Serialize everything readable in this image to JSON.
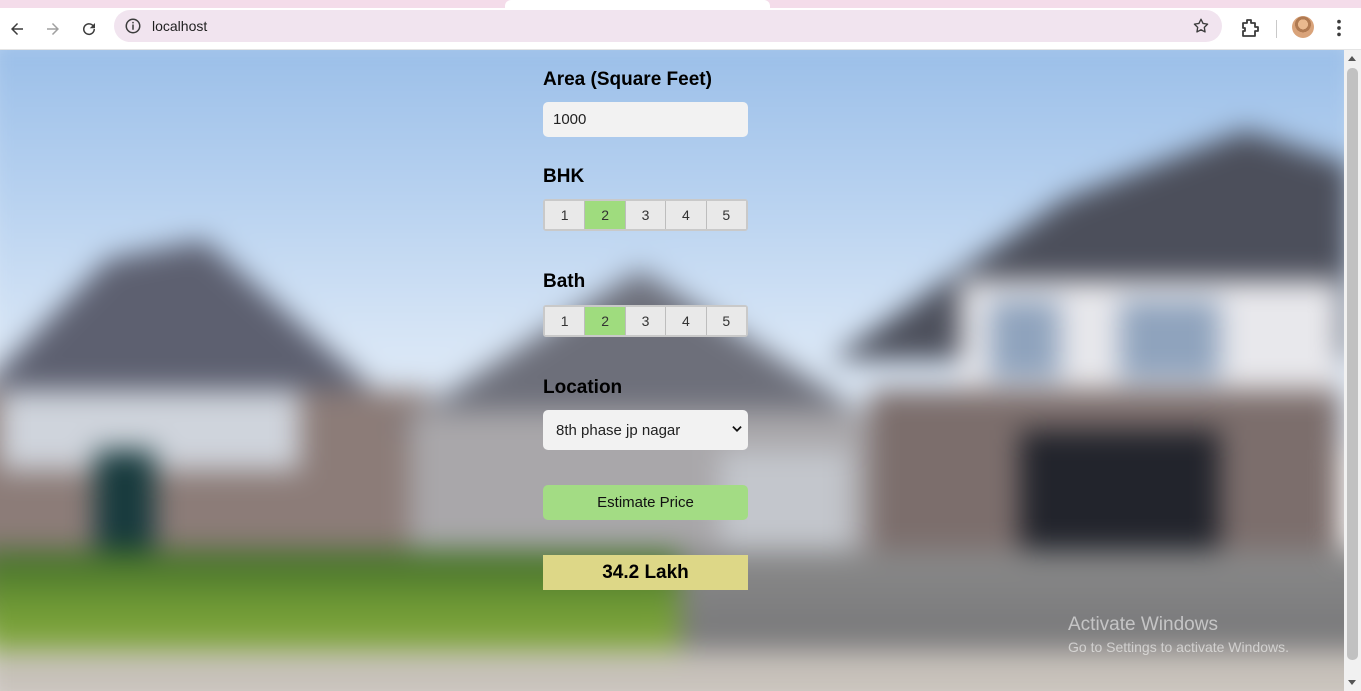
{
  "browser": {
    "url": "localhost"
  },
  "form": {
    "area": {
      "label": "Area (Square Feet)",
      "value": "1000"
    },
    "bhk": {
      "label": "BHK",
      "options": [
        "1",
        "2",
        "3",
        "4",
        "5"
      ],
      "selected": "2"
    },
    "bath": {
      "label": "Bath",
      "options": [
        "1",
        "2",
        "3",
        "4",
        "5"
      ],
      "selected": "2"
    },
    "location": {
      "label": "Location",
      "selected": "8th phase jp nagar"
    },
    "estimate_label": "Estimate Price",
    "result": "34.2 Lakh"
  },
  "watermark": {
    "line1": "Activate Windows",
    "line2": "Go to Settings to activate Windows."
  },
  "colors": {
    "selected_option": "#9fdc7e",
    "estimate_button": "#a3dc84",
    "result_box": "#ddd787"
  }
}
